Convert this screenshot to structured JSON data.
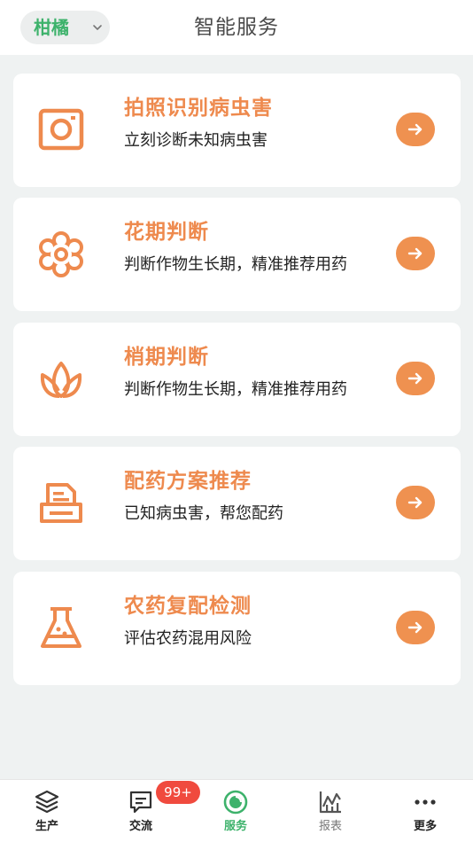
{
  "header": {
    "crop_selector": "柑橘",
    "title": "智能服务"
  },
  "cards": [
    {
      "title": "拍照识别病虫害",
      "desc": "立刻诊断未知病虫害",
      "icon": "camera-icon"
    },
    {
      "title": "花期判断",
      "desc": "判断作物生长期，精准推荐用药",
      "icon": "flower-icon"
    },
    {
      "title": "梢期判断",
      "desc": "判断作物生长期，精准推荐用药",
      "icon": "lotus-icon"
    },
    {
      "title": "配药方案推荐",
      "desc": "已知病虫害，帮您配药",
      "icon": "printer-icon"
    },
    {
      "title": "农药复配检测",
      "desc": "评估农药混用风险",
      "icon": "flask-icon"
    }
  ],
  "tabbar": {
    "items": [
      {
        "label": "生产",
        "icon": "layers-icon"
      },
      {
        "label": "交流",
        "icon": "chat-icon",
        "badge": "99+"
      },
      {
        "label": "服务",
        "icon": "service-icon",
        "active": true
      },
      {
        "label": "报表",
        "icon": "chart-icon"
      },
      {
        "label": "更多",
        "icon": "more-icon"
      }
    ]
  },
  "colors": {
    "accent": "#ee8a4e",
    "brand_green": "#3db26b",
    "badge": "#f04a3e",
    "background": "#eff2f2"
  }
}
